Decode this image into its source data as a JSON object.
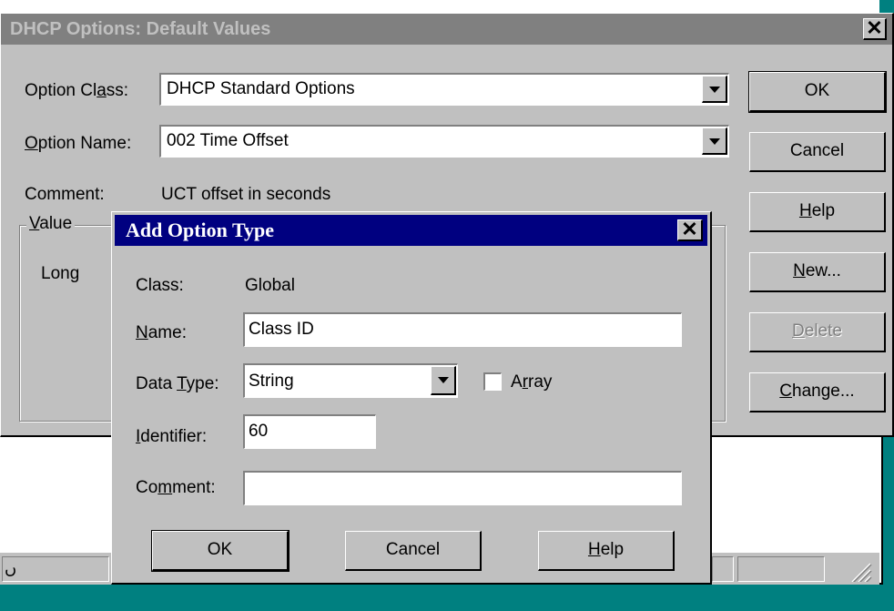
{
  "main_dialog": {
    "title": "DHCP Options: Default Values",
    "close_glyph": "✕",
    "option_class_label": "Option Class:",
    "option_class_value": "DHCP Standard Options",
    "option_name_label": "Option Name:",
    "option_name_value": "002 Time Offset",
    "comment_label": "Comment:",
    "comment_value": "UCT offset in seconds",
    "value_group_label": "Value",
    "value_type": "Long",
    "buttons": {
      "ok": "OK",
      "cancel": "Cancel",
      "help": "Help",
      "new": "New...",
      "delete": "Delete",
      "change": "Change..."
    }
  },
  "background": {
    "status_left_text": "ں"
  },
  "add_option_dialog": {
    "title": "Add Option Type",
    "close_glyph": "✕",
    "class_label": "Class:",
    "class_value": "Global",
    "name_label": "Name:",
    "name_value": "Class ID",
    "data_type_label": "Data Type:",
    "data_type_value": "String",
    "array_label": "Array",
    "array_checked": false,
    "identifier_label": "Identifier:",
    "identifier_value": "60",
    "comment_label": "Comment:",
    "comment_value": "",
    "buttons": {
      "ok": "OK",
      "cancel": "Cancel",
      "help": "Help"
    }
  },
  "colors": {
    "face": "#c0c0c0",
    "active_title": "#000080",
    "inactive_title": "#808080",
    "desktop": "#008080"
  }
}
